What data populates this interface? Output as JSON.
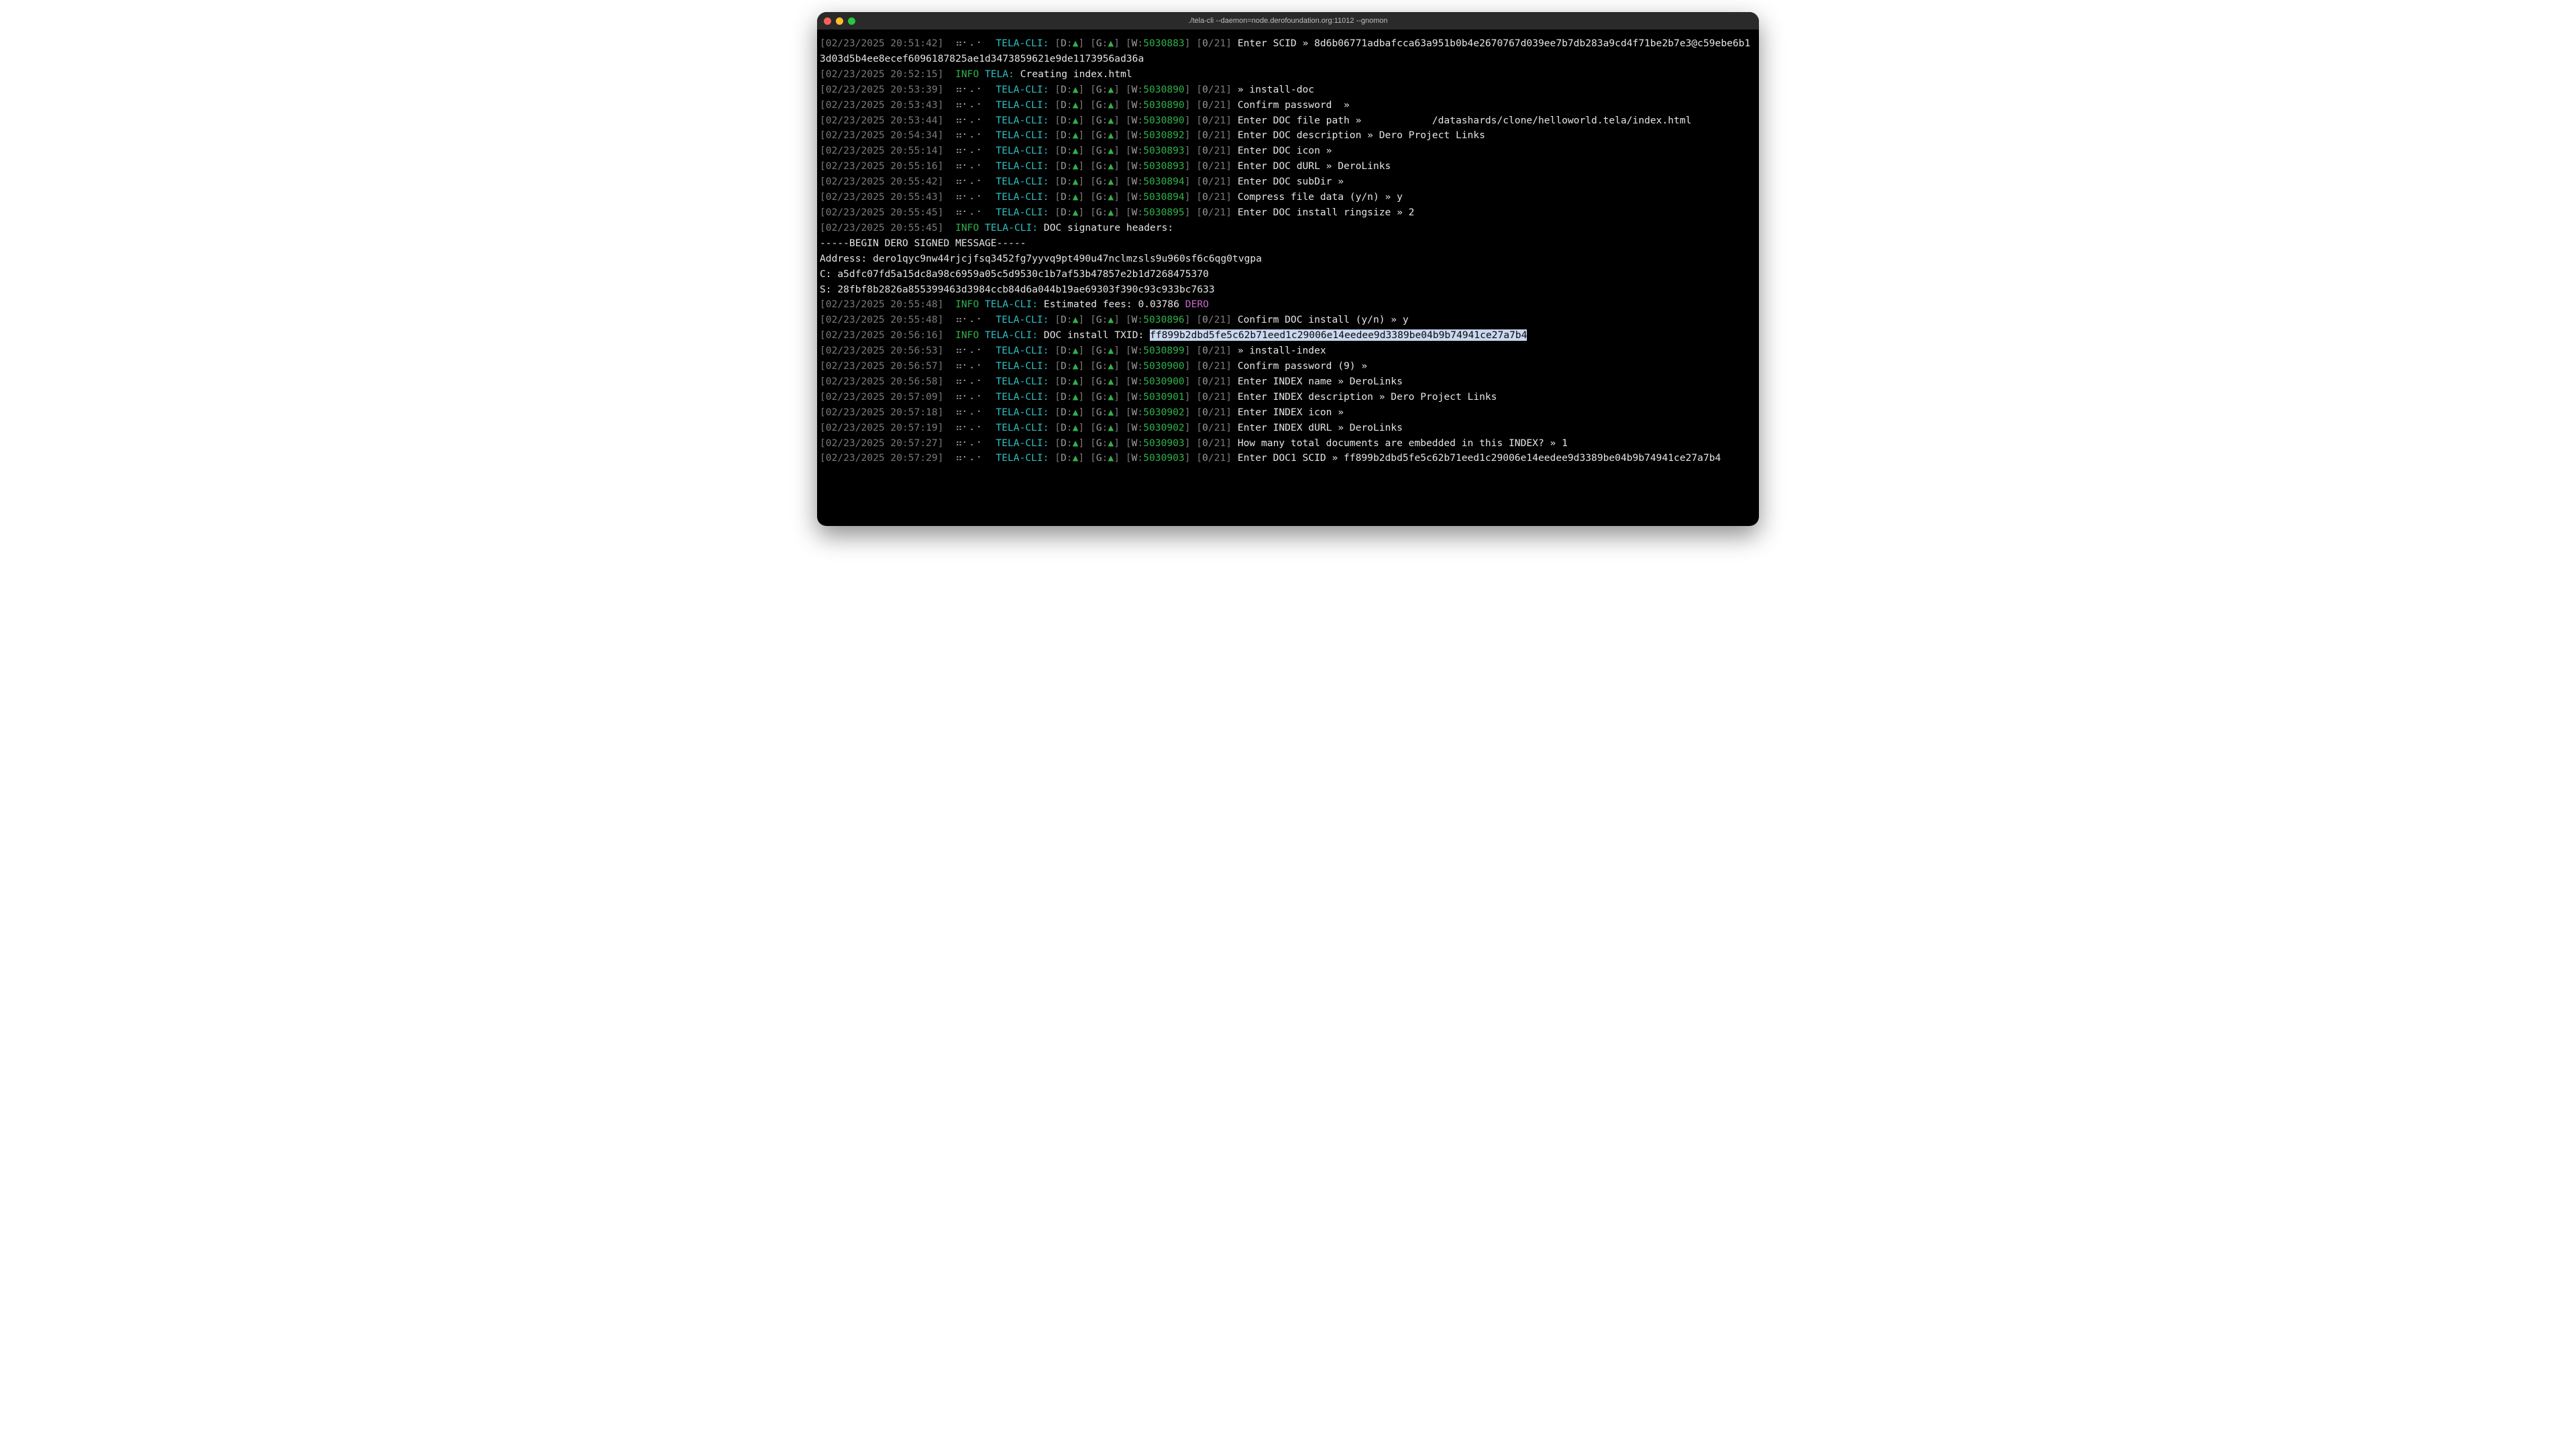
{
  "window": {
    "title": "./tela-cli --daemon=node.derofoundation.org:11012 --gnomon"
  },
  "cli_label": "TELA-CLI:",
  "info_label": "INFO",
  "tela_label": "TELA:",
  "braille": "⠶⠂⠄⠂",
  "up_arrow": "▲",
  "lines": [
    {
      "type": "cli",
      "ts": "[02/23/2025 20:51:42]",
      "w": "5030883",
      "count": [
        "0",
        "21"
      ],
      "body": "Enter SCID » 8d6b06771adbafcca63a951b0b4e2670767d039ee7b7db283a9cd4f71be2b7e3@c59ebe6b13d03d5b4ee8ecef6096187825ae1d3473859621e9de1173956ad36a"
    },
    {
      "type": "info_tela",
      "ts": "[02/23/2025 20:52:15]",
      "body": "Creating index.html"
    },
    {
      "type": "cli",
      "ts": "[02/23/2025 20:53:39]",
      "w": "5030890",
      "count": [
        "0",
        "21"
      ],
      "body": "» install-doc"
    },
    {
      "type": "cli",
      "ts": "[02/23/2025 20:53:43]",
      "w": "5030890",
      "count": [
        "0",
        "21"
      ],
      "body": "Confirm password  »"
    },
    {
      "type": "cli",
      "ts": "[02/23/2025 20:53:44]",
      "w": "5030890",
      "count": [
        "0",
        "21"
      ],
      "body": "Enter DOC file path »            /datashards/clone/helloworld.tela/index.html"
    },
    {
      "type": "cli",
      "ts": "[02/23/2025 20:54:34]",
      "w": "5030892",
      "count": [
        "0",
        "21"
      ],
      "body": "Enter DOC description » Dero Project Links"
    },
    {
      "type": "cli",
      "ts": "[02/23/2025 20:55:14]",
      "w": "5030893",
      "count": [
        "0",
        "21"
      ],
      "body": "Enter DOC icon »"
    },
    {
      "type": "cli",
      "ts": "[02/23/2025 20:55:16]",
      "w": "5030893",
      "count": [
        "0",
        "21"
      ],
      "body": "Enter DOC dURL » DeroLinks"
    },
    {
      "type": "cli",
      "ts": "[02/23/2025 20:55:42]",
      "w": "5030894",
      "count": [
        "0",
        "21"
      ],
      "body": "Enter DOC subDir »"
    },
    {
      "type": "cli",
      "ts": "[02/23/2025 20:55:43]",
      "w": "5030894",
      "count": [
        "0",
        "21"
      ],
      "body": "Compress file data (y/n) » y"
    },
    {
      "type": "cli",
      "ts": "[02/23/2025 20:55:45]",
      "w": "5030895",
      "count": [
        "0",
        "21"
      ],
      "body": "Enter DOC install ringsize » 2"
    },
    {
      "type": "info_cli",
      "ts": "[02/23/2025 20:55:45]",
      "body": "DOC signature headers:"
    },
    {
      "type": "plain",
      "body": "-----BEGIN DERO SIGNED MESSAGE-----"
    },
    {
      "type": "plain",
      "body": "Address: dero1qyc9nw44rjcjfsq3452fg7yyvq9pt490u47nclmzsls9u960sf6c6qg0tvgpa"
    },
    {
      "type": "plain",
      "body": "C: a5dfc07fd5a15dc8a98c6959a05c5d9530c1b7af53b47857e2b1d7268475370"
    },
    {
      "type": "plain",
      "body": "S: 28fbf8b2826a855399463d3984ccb84d6a044b19ae69303f390c93c933bc7633"
    },
    {
      "type": "info_cli_dero",
      "ts": "[02/23/2025 20:55:48]",
      "body": "Estimated fees: 0.03786 ",
      "dero": "DERO"
    },
    {
      "type": "cli",
      "ts": "[02/23/2025 20:55:48]",
      "w": "5030896",
      "count": [
        "0",
        "21"
      ],
      "body": "Confirm DOC install (y/n) » y"
    },
    {
      "type": "info_cli_txid",
      "ts": "[02/23/2025 20:56:16]",
      "body": "DOC install TXID: ",
      "txid": "ff899b2dbd5fe5c62b71eed1c29006e14eedee9d3389be04b9b74941ce27a7b4"
    },
    {
      "type": "cli",
      "ts": "[02/23/2025 20:56:53]",
      "w": "5030899",
      "count": [
        "0",
        "21"
      ],
      "body": "» install-index"
    },
    {
      "type": "cli",
      "ts": "[02/23/2025 20:56:57]",
      "w": "5030900",
      "count": [
        "0",
        "21"
      ],
      "body": "Confirm password (9) »"
    },
    {
      "type": "cli",
      "ts": "[02/23/2025 20:56:58]",
      "w": "5030900",
      "count": [
        "0",
        "21"
      ],
      "body": "Enter INDEX name » DeroLinks"
    },
    {
      "type": "cli",
      "ts": "[02/23/2025 20:57:09]",
      "w": "5030901",
      "count": [
        "0",
        "21"
      ],
      "body": "Enter INDEX description » Dero Project Links"
    },
    {
      "type": "cli",
      "ts": "[02/23/2025 20:57:18]",
      "w": "5030902",
      "count": [
        "0",
        "21"
      ],
      "body": "Enter INDEX icon »"
    },
    {
      "type": "cli",
      "ts": "[02/23/2025 20:57:19]",
      "w": "5030902",
      "count": [
        "0",
        "21"
      ],
      "body": "Enter INDEX dURL » DeroLinks"
    },
    {
      "type": "cli",
      "ts": "[02/23/2025 20:57:27]",
      "w": "5030903",
      "count": [
        "0",
        "21"
      ],
      "body": "How many total documents are embedded in this INDEX? » 1"
    },
    {
      "type": "cli",
      "ts": "[02/23/2025 20:57:29]",
      "w": "5030903",
      "count": [
        "0",
        "21"
      ],
      "body": "Enter DOC1 SCID » ff899b2dbd5fe5c62b71eed1c29006e14eedee9d3389be04b9b74941ce27a7b4"
    }
  ]
}
